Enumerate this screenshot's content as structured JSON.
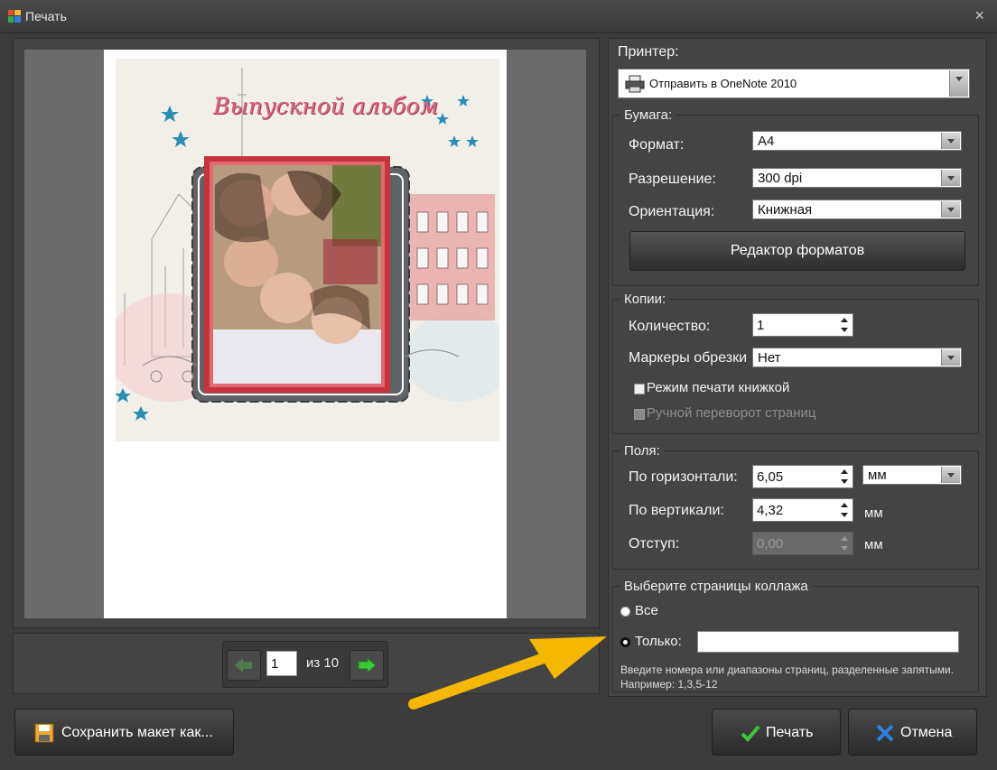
{
  "window": {
    "title": "Печать",
    "close_glyph": "×"
  },
  "preview": {
    "album_title": "Выпускной альбом",
    "nav": {
      "current_page": "1",
      "total_label": "из 10"
    }
  },
  "printer": {
    "label": "Принтер:",
    "selected": "Отправить в OneNote 2010"
  },
  "paper": {
    "group_title": "Бумага:",
    "format_label": "Формат:",
    "format_value": "A4",
    "resolution_label": "Разрешение:",
    "resolution_value": "300 dpi",
    "orientation_label": "Ориентация:",
    "orientation_value": "Книжная",
    "format_editor_button": "Редактор форматов"
  },
  "copies": {
    "group_title": "Копии:",
    "quantity_label": "Количество:",
    "quantity_value": "1",
    "crop_marks_label": "Маркеры обрезки",
    "crop_marks_value": "Нет",
    "booklet_label": "Режим печати книжкой",
    "manual_flip_label": "Ручной переворот страниц"
  },
  "margins": {
    "group_title": "Поля:",
    "horizontal_label": "По горизонтали:",
    "horizontal_value": "6,05",
    "horizontal_unit": "мм",
    "vertical_label": "По вертикали:",
    "vertical_value": "4,32",
    "vertical_unit": "мм",
    "indent_label": "Отступ:",
    "indent_value": "0,00",
    "indent_unit": "мм"
  },
  "pages": {
    "group_title": "Выберите страницы коллажа",
    "all_label": "Все",
    "only_label": "Только:",
    "only_value": "",
    "hint": "Введите номера или диапазоны страниц, разделенные запятыми. Например: 1,3,5-12"
  },
  "footer": {
    "save_layout_button": "Сохранить макет как...",
    "print_button": "Печать",
    "cancel_button": "Отмена"
  },
  "colors": {
    "panel_bg": "#444444",
    "accent_arrow": "#f5b800",
    "title_pink": "#d9667e",
    "frame_red": "#c8323c",
    "star_teal": "#2a8fb5",
    "print_check_green": "#3cc83c",
    "cancel_x_blue": "#2f7fe0"
  },
  "icons": {
    "printer": "printer-icon",
    "prev": "arrow-left-icon",
    "next": "arrow-right-icon",
    "save": "floppy-disk-icon",
    "print": "checkmark-icon",
    "cancel": "x-icon",
    "app": "app-logo-icon"
  }
}
